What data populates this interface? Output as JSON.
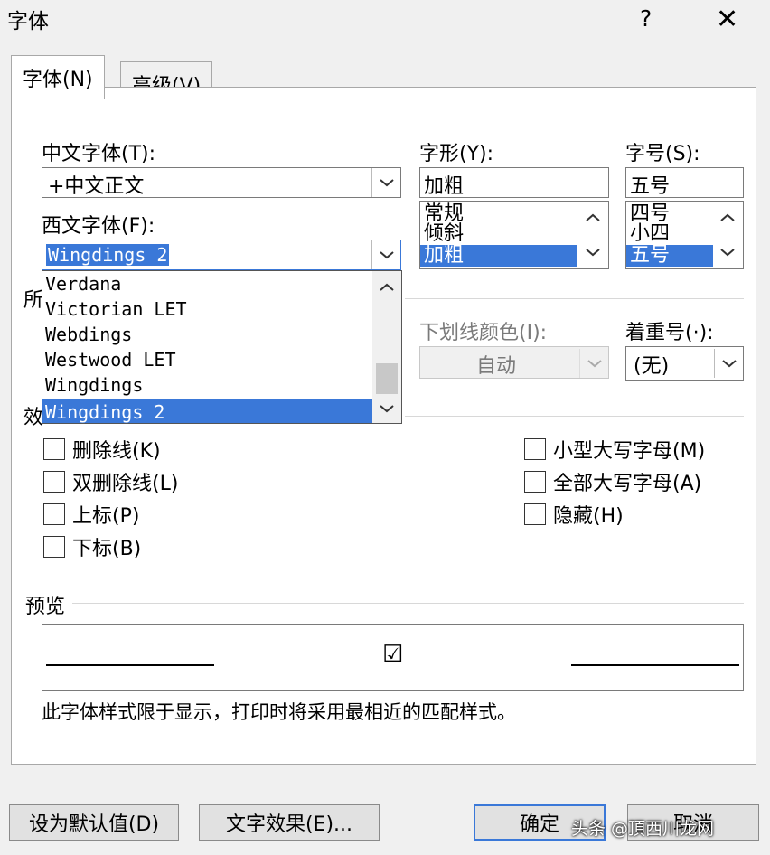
{
  "window": {
    "title": "字体",
    "help": "?",
    "close": "✕"
  },
  "tabs": [
    {
      "label": "字体(N)",
      "active": true
    },
    {
      "label": "高级(V)",
      "active": false
    }
  ],
  "chinese_font": {
    "label": "中文字体(T):",
    "value": "+中文正文"
  },
  "western_font": {
    "label": "西文字体(F):",
    "value": "Wingdings 2"
  },
  "font_list": {
    "items": [
      "Verdana",
      "Victorian LET",
      "Webdings",
      "Westwood LET",
      "Wingdings",
      "Wingdings 2"
    ],
    "selected": "Wingdings 2"
  },
  "style": {
    "label": "字形(Y):",
    "value": "加粗",
    "items": [
      "常规",
      "倾斜",
      "加粗"
    ],
    "selected": "加粗"
  },
  "size": {
    "label": "字号(S):",
    "value": "五号",
    "items": [
      "四号",
      "小四",
      "五号"
    ],
    "selected": "五号"
  },
  "all_text_partial": "所",
  "underline_color": {
    "label": "下划线颜色(I):",
    "value": "自动"
  },
  "emphasis": {
    "label": "着重号(·):",
    "value": "(无)"
  },
  "effects_partial": "效",
  "effects_left": [
    {
      "label": "删除线(K)",
      "checked": false
    },
    {
      "label": "双删除线(L)",
      "checked": false
    },
    {
      "label": "上标(P)",
      "checked": false
    },
    {
      "label": "下标(B)",
      "checked": false
    }
  ],
  "effects_right": [
    {
      "label": "小型大写字母(M)",
      "checked": false
    },
    {
      "label": "全部大写字母(A)",
      "checked": false
    },
    {
      "label": "隐藏(H)",
      "checked": false
    }
  ],
  "preview": {
    "label": "预览",
    "glyph": "☑",
    "note": "此字体样式限于显示，打印时将采用最相近的匹配样式。"
  },
  "buttons": {
    "default": "设为默认值(D)",
    "effects": "文字效果(E)...",
    "ok": "确定",
    "cancel": "取消"
  },
  "watermark": "头条 @頂西川龙网"
}
